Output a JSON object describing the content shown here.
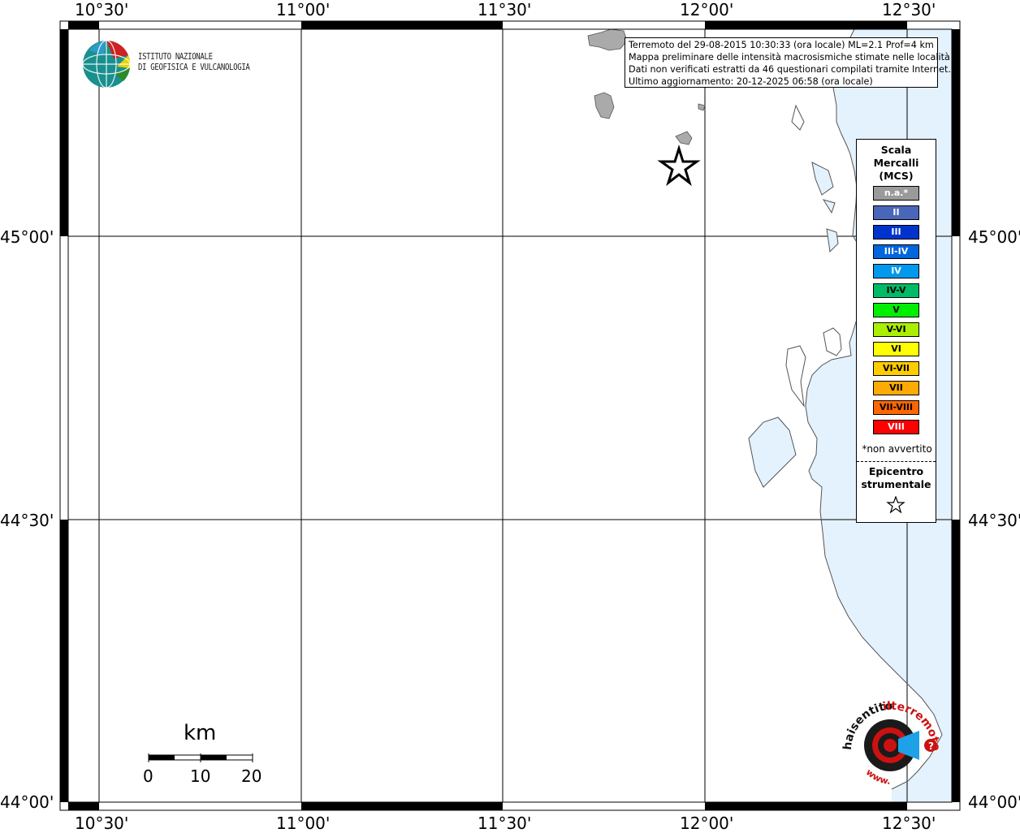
{
  "event_info": {
    "line1": "Terremoto del 29-08-2015 10:30:33 (ora locale) ML=2.1 Prof=4 km",
    "line2": "Mappa preliminare delle intensità macrosismiche stimate nelle località",
    "line3": "Dati non verificati estratti da 46 questionari compilati tramite Internet.",
    "line4": "Ultimo aggiornamento: 20-12-2025 06:58 (ora locale)"
  },
  "logo": {
    "line1": "ISTITUTO NAZIONALE",
    "line2": "DI GEOFISICA E VULCANOLOGIA"
  },
  "axes": {
    "lon_ticks": [
      "10°30'",
      "11°00'",
      "11°30'",
      "12°00'",
      "12°30'"
    ],
    "lat_ticks": [
      "45°00'",
      "44°30'",
      "44°00'"
    ]
  },
  "legend": {
    "title": "Scala Mercalli (MCS)",
    "items": [
      {
        "label": "n.a.*",
        "color": "#9a9a9a",
        "text_color": "#ffffff"
      },
      {
        "label": "II",
        "color": "#4a66b8",
        "text_color": "#ffffff"
      },
      {
        "label": "III",
        "color": "#0033cc",
        "text_color": "#ffffff"
      },
      {
        "label": "III-IV",
        "color": "#0066dd",
        "text_color": "#ffffff"
      },
      {
        "label": "IV",
        "color": "#0099ee",
        "text_color": "#ffffff"
      },
      {
        "label": "IV-V",
        "color": "#00bb66",
        "text_color": "#000000"
      },
      {
        "label": "V",
        "color": "#00ee00",
        "text_color": "#000000"
      },
      {
        "label": "V-VI",
        "color": "#aaee00",
        "text_color": "#000000"
      },
      {
        "label": "VI",
        "color": "#ffff00",
        "text_color": "#000000"
      },
      {
        "label": "VI-VII",
        "color": "#ffcc00",
        "text_color": "#000000"
      },
      {
        "label": "VII",
        "color": "#ffaa00",
        "text_color": "#000000"
      },
      {
        "label": "VII-VIII",
        "color": "#ff6600",
        "text_color": "#000000"
      },
      {
        "label": "VIII",
        "color": "#ff0000",
        "text_color": "#ffffff"
      }
    ],
    "note": "*non avvertito",
    "epicenter_label": "Epicentro strumentale"
  },
  "scale_bar": {
    "unit": "km",
    "labels": [
      "0",
      "10",
      "20"
    ]
  },
  "hst_logo": {
    "text": "www.haisentitoilterremoto.it ?"
  },
  "colors": {
    "sea": "#e3f2fd",
    "land_foreign": "#aaaaaa",
    "coastline": "#555555"
  }
}
